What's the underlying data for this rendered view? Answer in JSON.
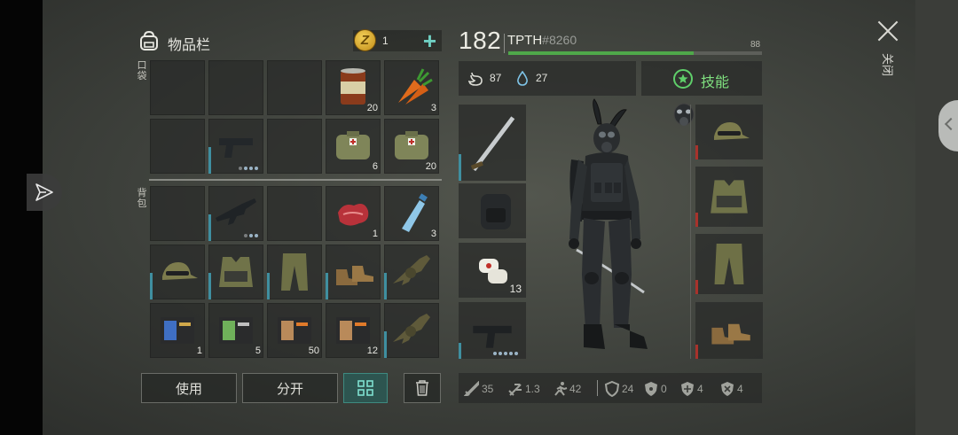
{
  "inventory": {
    "title": "物品栏",
    "coins": "1",
    "plus_label": "+",
    "pocket_label": "口袋",
    "backpack_label": "背包",
    "pocket_slots": [
      {
        "item": "",
        "count": ""
      },
      {
        "item": "",
        "count": ""
      },
      {
        "item": "",
        "count": ""
      },
      {
        "item": "canned-food",
        "count": "20"
      },
      {
        "item": "carrot",
        "count": "3"
      },
      {
        "item": "",
        "count": ""
      },
      {
        "item": "pistol",
        "count": "",
        "dots": 4,
        "bar": "blue"
      },
      {
        "item": "",
        "count": ""
      },
      {
        "item": "first-aid-bag",
        "count": "6"
      },
      {
        "item": "first-aid-bag",
        "count": "20"
      }
    ],
    "backpack_slots": [
      {
        "item": "",
        "count": ""
      },
      {
        "item": "rifle",
        "count": "",
        "dots": 3,
        "bar": "blue"
      },
      {
        "item": "",
        "count": ""
      },
      {
        "item": "raw-meat",
        "count": "1"
      },
      {
        "item": "water-bottle",
        "count": "3"
      },
      {
        "item": "camo-cap",
        "count": "",
        "bar": "blue"
      },
      {
        "item": "camo-vest",
        "count": "",
        "bar": "blue"
      },
      {
        "item": "camo-pants",
        "count": "",
        "bar": "blue"
      },
      {
        "item": "boots",
        "count": "",
        "bar": "blue"
      },
      {
        "item": "grenade-launcher",
        "count": "",
        "bar": "blue"
      },
      {
        "item": "id-card-blue",
        "count": "1"
      },
      {
        "item": "id-card-green",
        "count": "5"
      },
      {
        "item": "id-card-orange",
        "count": "50"
      },
      {
        "item": "id-card-orange",
        "count": "12"
      },
      {
        "item": "grenade-launcher",
        "count": "",
        "bar": "blue"
      }
    ],
    "buttons": {
      "use": "使用",
      "split": "分开"
    }
  },
  "character": {
    "level": "182",
    "name": "TPTH",
    "tag": "#8260",
    "xp_max": "88",
    "xp_fraction": 0.73,
    "hunger": "87",
    "thirst": "27",
    "skills_label": "技能",
    "weapon_slots": [
      {
        "item": "katana",
        "count": "",
        "bar": "blue"
      },
      {
        "item": "backpack",
        "count": ""
      },
      {
        "item": "bandage",
        "count": "13"
      },
      {
        "item": "uzi",
        "count": "",
        "dots": 5,
        "bar": "blue"
      }
    ],
    "armor_slots": [
      {
        "item": "camo-cap",
        "bar": "red"
      },
      {
        "item": "camo-vest",
        "bar": "red"
      },
      {
        "item": "camo-pants",
        "bar": "red"
      },
      {
        "item": "boots",
        "bar": "red"
      }
    ],
    "stats": [
      {
        "icon": "sword-icon",
        "value": "35"
      },
      {
        "icon": "attack-speed-icon",
        "value": "1.3"
      },
      {
        "icon": "run-icon",
        "value": "42"
      },
      {
        "icon": "shield-icon",
        "value": "24"
      },
      {
        "icon": "radiation-icon",
        "value": "0"
      },
      {
        "icon": "cold-icon",
        "value": "4"
      },
      {
        "icon": "frost-shield-icon",
        "value": "4"
      }
    ]
  },
  "close_label": "关闭",
  "colors": {
    "accent_teal": "#6fd0c3",
    "xp_green": "#4fa84a",
    "skills_green": "#7fe07f",
    "durability_blue": "#3f8fa0",
    "durability_red": "#a8322b"
  }
}
